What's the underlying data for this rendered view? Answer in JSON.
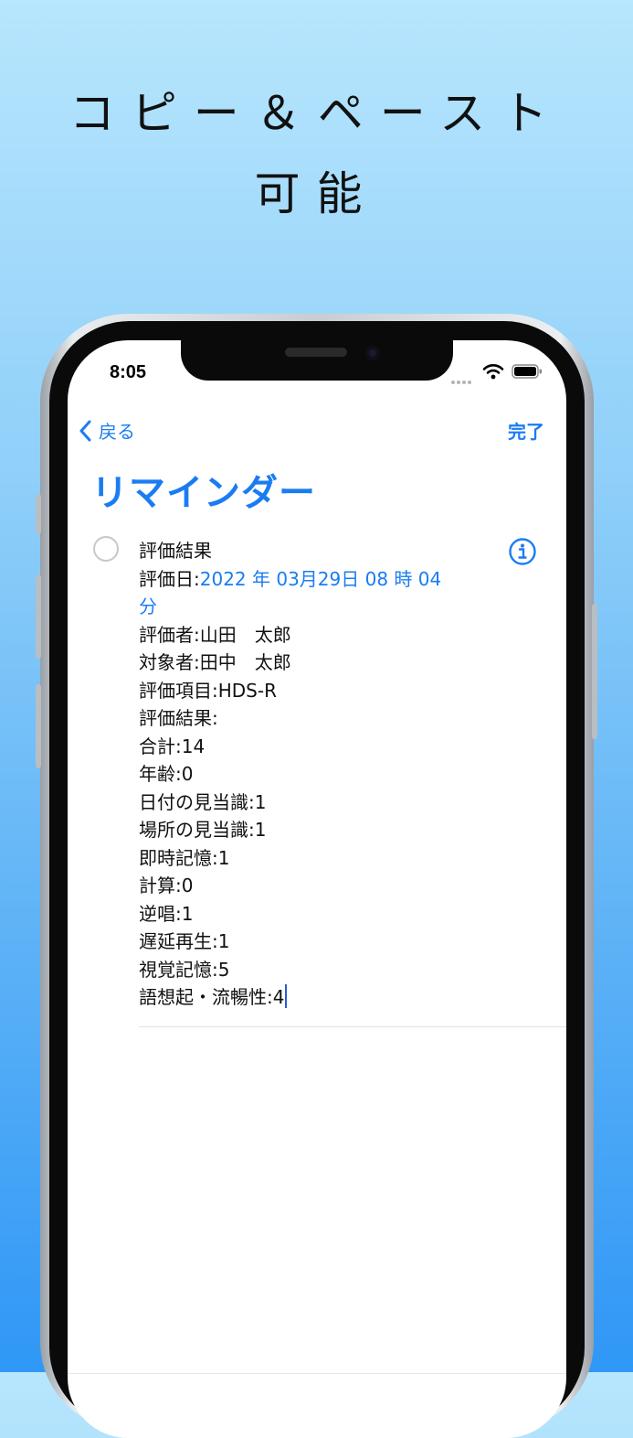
{
  "headline": {
    "line1": "コピー＆ペースト",
    "line2": "可能"
  },
  "status_bar": {
    "time": "8:05"
  },
  "nav": {
    "back_label": "戻る",
    "done_label": "完了"
  },
  "page": {
    "title": "リマインダー"
  },
  "reminder": {
    "lines": {
      "l1": "評価結果",
      "l2_prefix": "評価日:",
      "l2_date_a": "2022 年 03月29日 08 時 04",
      "l2_date_b": "分",
      "l3": "評価者:山田　太郎",
      "l4": "対象者:田中　太郎",
      "l5": "評価項目:HDS-R",
      "l6": "評価結果:",
      "l7": "合計:14",
      "l8": "年齢:0",
      "l9": "日付の見当識:1",
      "l10": "場所の見当識:1",
      "l11": "即時記憶:1",
      "l12": "計算:0",
      "l13": "逆唱:1",
      "l14": "遅延再生:1",
      "l15": "視覚記憶:5",
      "l16": "語想起・流暢性:4"
    }
  },
  "icons": {
    "back": "chevron-left-icon",
    "info": "info-circle-icon",
    "wifi": "wifi-icon",
    "battery": "battery-icon",
    "checkbox": "empty-circle-icon"
  },
  "colors": {
    "accent": "#1a7cf2",
    "caret": "#2a5bd7"
  }
}
